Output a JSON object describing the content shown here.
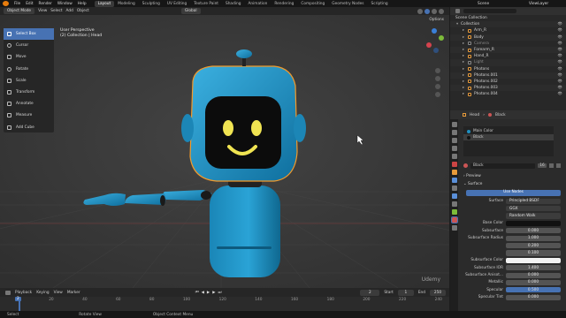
{
  "topbar": {
    "menus": [
      "File",
      "Edit",
      "Render",
      "Window",
      "Help"
    ],
    "workspaces": [
      "Layout",
      "Modeling",
      "Sculpting",
      "UV Editing",
      "Texture Paint",
      "Shading",
      "Animation",
      "Rendering",
      "Compositing",
      "Geometry Nodes",
      "Scripting"
    ],
    "active_workspace": "Layout",
    "scene": "Scene",
    "view_layer": "ViewLayer"
  },
  "viewport_header": {
    "mode": "Object Mode",
    "menus": [
      "View",
      "Select",
      "Add",
      "Object"
    ],
    "orientation": "Global",
    "options": "Options"
  },
  "viewport": {
    "view_name": "User Perspective",
    "collection_path": "(2) Collection | Head"
  },
  "toolbar": {
    "tools": [
      "Select Box",
      "Cursor",
      "Move",
      "Rotate",
      "Scale",
      "Transform",
      "Annotate",
      "Measure",
      "Add Cube"
    ],
    "active": "Select Box"
  },
  "timeline": {
    "menus": [
      "Playback",
      "Keying",
      "View",
      "Marker"
    ],
    "current_frame": "2",
    "start_label": "Start",
    "start": "1",
    "end_label": "End",
    "end": "250",
    "ticks": [
      "0",
      "20",
      "40",
      "60",
      "80",
      "100",
      "120",
      "140",
      "160",
      "180",
      "200",
      "220",
      "240"
    ]
  },
  "statusbar": {
    "items": [
      "Select",
      "Rotate View",
      "Object Context Menu"
    ]
  },
  "outliner": {
    "title": "Scene Collection",
    "items": [
      {
        "name": "Collection",
        "indent": 0
      },
      {
        "name": "Arm_R",
        "indent": 1
      },
      {
        "name": "Body",
        "indent": 1
      },
      {
        "name": "Camera",
        "indent": 1
      },
      {
        "name": "Forearm_R",
        "indent": 1
      },
      {
        "name": "Hand_R",
        "indent": 1
      },
      {
        "name": "Light",
        "indent": 1
      },
      {
        "name": "Photons",
        "indent": 1
      },
      {
        "name": "Photons.001",
        "indent": 1
      },
      {
        "name": "Photons.002",
        "indent": 1
      },
      {
        "name": "Photons.003",
        "indent": 1
      },
      {
        "name": "Photons.004",
        "indent": 1
      }
    ]
  },
  "properties": {
    "breadcrumb_object": "Head",
    "breadcrumb_material": "Black",
    "slots": [
      "Main Color",
      "Black"
    ],
    "material_name": "Black",
    "users": "16",
    "sections": {
      "preview": "Preview",
      "surface": "Surface"
    },
    "use_nodes": "Use Nodes",
    "rows": [
      {
        "label": "Surface",
        "value": "Principled BSDF",
        "style": "dark"
      },
      {
        "label": "",
        "value": "GGX",
        "style": "dark"
      },
      {
        "label": "",
        "value": "Random Walk",
        "style": "dark"
      },
      {
        "label": "Base Color",
        "value": "",
        "style": "dark"
      },
      {
        "label": "Subsurface",
        "value": "0.000",
        "style": "grey"
      },
      {
        "label": "Subsurface Radius",
        "value": "1.000",
        "style": "grey"
      },
      {
        "label": "",
        "value": "0.200",
        "style": "grey"
      },
      {
        "label": "",
        "value": "0.100",
        "style": "grey"
      },
      {
        "label": "Subsurface Color",
        "value": "",
        "style": "white"
      },
      {
        "label": "Subsurface IOR",
        "value": "1.400",
        "style": "grey"
      },
      {
        "label": "Subsurface Anisot...",
        "value": "0.000",
        "style": "grey"
      },
      {
        "label": "Metallic",
        "value": "0.000",
        "style": "grey"
      },
      {
        "label": "Specular",
        "value": "0.500",
        "style": "blue"
      },
      {
        "label": "Specular Tint",
        "value": "0.000",
        "style": "grey"
      }
    ]
  },
  "watermark": "Udemy",
  "colors": {
    "accent": "#4772b3",
    "robot": "#1e8fc0",
    "robot_dark": "#11668f",
    "face": "#f0e452",
    "selection_outline": "#f39a2a"
  }
}
